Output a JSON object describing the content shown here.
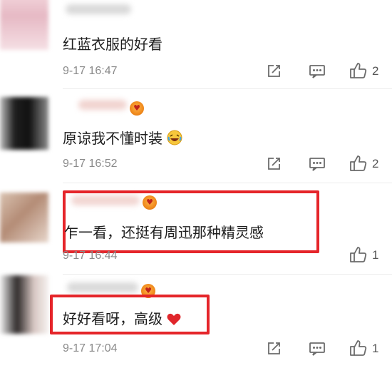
{
  "comments": [
    {
      "text": "红蓝衣服的好看",
      "time": "9-17 16:47",
      "likes": "2"
    },
    {
      "text": "原谅我不懂时装",
      "time": "9-17 16:52",
      "likes": "2"
    },
    {
      "text": "乍一看，还挺有周迅那种精灵感",
      "time": "9-17 16:44",
      "likes": "1"
    },
    {
      "text": "好好看呀，高级",
      "time": "9-17 17:04",
      "likes": "1"
    }
  ],
  "icons": {
    "share": "share-icon",
    "reply": "comment-icon",
    "like": "thumbs-up-icon",
    "laugh_emoji": "laughing-face-icon",
    "heart_emoji": "heart-icon"
  },
  "colors": {
    "highlight_box": "#e5252a",
    "timestamp": "#8a8a8a",
    "icon": "#6b6b6b"
  }
}
